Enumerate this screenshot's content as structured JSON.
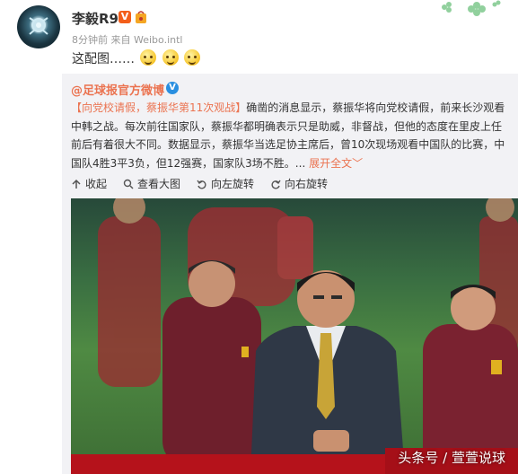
{
  "post": {
    "username": "李毅R9",
    "v_badge": "V",
    "meta": "8分钟前 来自 Weibo.intl",
    "text": "这配图……"
  },
  "repost": {
    "author": "@足球报官方微博",
    "author_badge": "V",
    "tag": "【向党校请假，蔡振华第11次观战】",
    "body": "确凿的消息显示，蔡振华将向党校请假，前来长沙观看中韩之战。每次前往国家队，蔡振华都明确表示只是助威，非督战，但他的态度在里皮上任前后有着很大不同。数据显示，蔡振华当选足协主席后，曾10次现场观看中国队的比赛，中国队4胜3平3负，但12强赛，国家队3场不胜。...",
    "expand": "展开全文",
    "toolbar": {
      "collapse": "收起",
      "view_large": "查看大图",
      "rotate_left": "向左旋转",
      "rotate_right": "向右旋转"
    }
  },
  "photo": {
    "watermark": "头条号 / 萱萱说球"
  },
  "colors": {
    "orange_link": "#eb7350",
    "repost_bg": "#f2f2f5",
    "v_badge_bg": "#f35e1a",
    "blue_v": "#2a8fe0"
  },
  "icons": [
    "avatar",
    "v-badge-icon",
    "bag-icon",
    "emoji-icon",
    "clover-decoration-icon",
    "collapse-icon",
    "magnifier-icon",
    "rotate-left-icon",
    "rotate-right-icon"
  ]
}
